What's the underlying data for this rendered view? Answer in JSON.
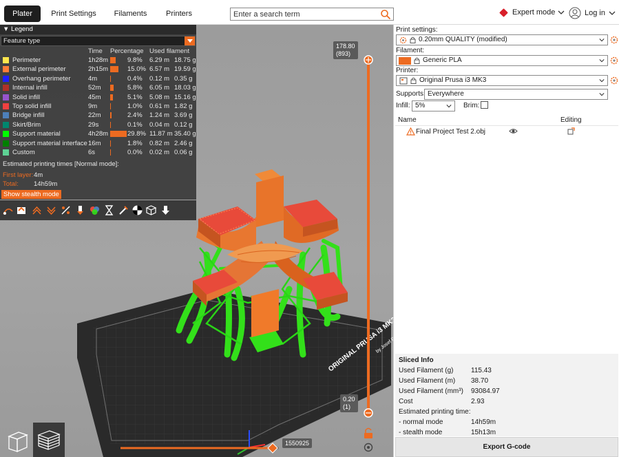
{
  "tabs": [
    {
      "label": "Plater",
      "active": true
    },
    {
      "label": "Print Settings",
      "active": false
    },
    {
      "label": "Filaments",
      "active": false
    },
    {
      "label": "Printers",
      "active": false
    }
  ],
  "search": {
    "placeholder": "Enter a search term"
  },
  "mode": {
    "label": "Expert mode",
    "color": "#d8202a"
  },
  "login": {
    "label": "Log in"
  },
  "legend": {
    "title": "Legend",
    "feature_select": "Feature type",
    "columns": {
      "time": "Time",
      "percentage": "Percentage",
      "used": "Used filament"
    },
    "rows": [
      {
        "name": "Perimeter",
        "color": "#ffe64d",
        "time": "1h28m",
        "percent": "9.8%",
        "pct": 9.8,
        "meters": "6.29 m",
        "grams": "18.75 g"
      },
      {
        "name": "External perimeter",
        "color": "#ff7d38",
        "time": "2h15m",
        "percent": "15.0%",
        "pct": 15.0,
        "meters": "6.57 m",
        "grams": "19.59 g"
      },
      {
        "name": "Overhang perimeter",
        "color": "#1f1fff",
        "time": "4m",
        "percent": "0.4%",
        "pct": 0.4,
        "meters": "0.12 m",
        "grams": "0.35 g"
      },
      {
        "name": "Internal infill",
        "color": "#b03029",
        "time": "52m",
        "percent": "5.8%",
        "pct": 5.8,
        "meters": "6.05 m",
        "grams": "18.03 g"
      },
      {
        "name": "Solid infill",
        "color": "#9654cc",
        "time": "45m",
        "percent": "5.1%",
        "pct": 5.1,
        "meters": "5.08 m",
        "grams": "15.16 g"
      },
      {
        "name": "Top solid infill",
        "color": "#f04040",
        "time": "9m",
        "percent": "1.0%",
        "pct": 1.0,
        "meters": "0.61 m",
        "grams": "1.82 g"
      },
      {
        "name": "Bridge infill",
        "color": "#4d80ba",
        "time": "22m",
        "percent": "2.4%",
        "pct": 2.4,
        "meters": "1.24 m",
        "grams": "3.69 g"
      },
      {
        "name": "Skirt/Brim",
        "color": "#00876e",
        "time": "29s",
        "percent": "0.1%",
        "pct": 0.1,
        "meters": "0.04 m",
        "grams": "0.12 g"
      },
      {
        "name": "Support material",
        "color": "#00ff00",
        "time": "4h28m",
        "percent": "29.8%",
        "pct": 29.8,
        "meters": "11.87 m",
        "grams": "35.40 g"
      },
      {
        "name": "Support material interface",
        "color": "#008000",
        "time": "16m",
        "percent": "1.8%",
        "pct": 1.8,
        "meters": "0.82 m",
        "grams": "2.46 g"
      },
      {
        "name": "Custom",
        "color": "#5ed194",
        "time": "6s",
        "percent": "0.0%",
        "pct": 0.0,
        "meters": "0.02 m",
        "grams": "0.06 g"
      }
    ],
    "estimated_title": "Estimated printing times [Normal mode]:",
    "first_layer_label": "First layer:",
    "first_layer_value": "4m",
    "total_label": "Total:",
    "total_value": "14h59m",
    "stealth_button": "Show stealth mode"
  },
  "sliders": {
    "top_value": "178.80",
    "top_layer": "(893)",
    "bottom_value": "0.20",
    "bottom_layer": "(1)",
    "horizontal_value": "1550925"
  },
  "bed_text": {
    "brand": "ORIGINAL PRUSA i3 MK3",
    "by": "by Josef Prusa"
  },
  "right": {
    "print_settings_label": "Print settings:",
    "print_settings_value": "0.20mm QUALITY (modified)",
    "filament_label": "Filament:",
    "filament_value": "Generic PLA",
    "filament_color": "#ed6b21",
    "printer_label": "Printer:",
    "printer_value": "Original Prusa i3 MK3",
    "supports_label": "Supports:",
    "supports_value": "Everywhere",
    "infill_label": "Infill:",
    "infill_value": "5%",
    "brim_label": "Brim:",
    "col_name": "Name",
    "col_editing": "Editing",
    "object_name": "Final Project Test 2.obj"
  },
  "sliced": {
    "title": "Sliced Info",
    "rows": [
      {
        "label": "Used Filament (g)",
        "value": "115.43"
      },
      {
        "label": "Used Filament (m)",
        "value": "38.70"
      },
      {
        "label": "Used Filament (mm³)",
        "value": "93084.97"
      },
      {
        "label": "Cost",
        "value": "2.93"
      },
      {
        "label": "Estimated printing time:",
        "value": ""
      },
      {
        "label": "- normal mode",
        "value": "14h59m"
      },
      {
        "label": "- stealth mode",
        "value": "15h13m"
      }
    ]
  },
  "export_button": "Export G-code",
  "accent_color": "#ed6b21"
}
